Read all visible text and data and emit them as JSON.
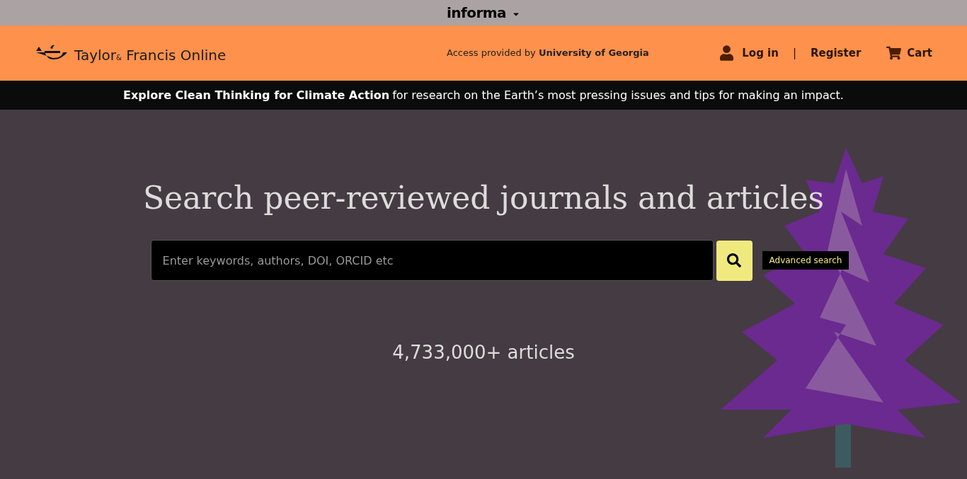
{
  "top_bar": {
    "brand": "informa"
  },
  "header": {
    "logo": {
      "word_1": "Taylor",
      "ampersand": "&",
      "word_2": "Francis Online"
    },
    "access": "Access provided by **University of Georgia**",
    "login": "Log in",
    "separator": "|",
    "register": "Register",
    "cart": "Cart"
  },
  "banner": {
    "link": "Explore Clean Thinking for Climate Action",
    "text": "for research on the Earth’s most pressing issues and tips for making an impact."
  },
  "hero": {
    "title": "Search peer-reviewed journals and articles",
    "search": {
      "placeholder": "Enter keywords, authors, DOI, ORCID etc"
    },
    "advanced_search": "Advanced search",
    "count": "4,733,000+ articles"
  }
}
